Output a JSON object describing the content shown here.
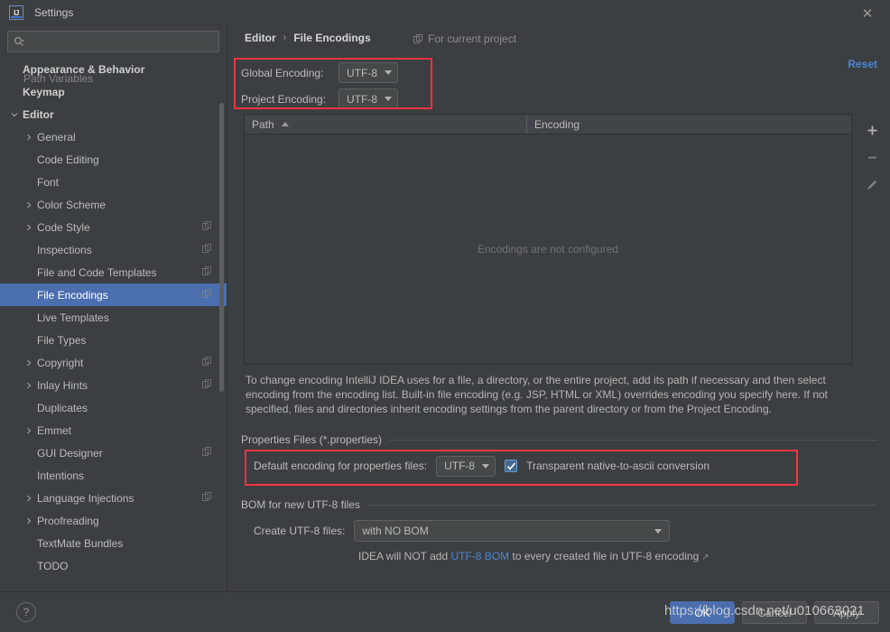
{
  "window": {
    "title": "Settings",
    "logo_text": "IJ",
    "close_icon": "close-icon"
  },
  "sidebar": {
    "search": {
      "value": "",
      "placeholder": ""
    },
    "items": [
      {
        "label": "Appearance & Behavior",
        "bold": true,
        "arrow": "",
        "indent": 0,
        "project_glyph": false
      },
      {
        "label": "Keymap",
        "bold": true,
        "arrow": "",
        "indent": 0,
        "project_glyph": false
      },
      {
        "label": "Editor",
        "bold": true,
        "arrow": "down",
        "indent": 0,
        "project_glyph": false
      },
      {
        "label": "General",
        "bold": false,
        "arrow": "right",
        "indent": 1,
        "project_glyph": false
      },
      {
        "label": "Code Editing",
        "bold": false,
        "arrow": "",
        "indent": 1,
        "project_glyph": false
      },
      {
        "label": "Font",
        "bold": false,
        "arrow": "",
        "indent": 1,
        "project_glyph": false
      },
      {
        "label": "Color Scheme",
        "bold": false,
        "arrow": "right",
        "indent": 1,
        "project_glyph": false
      },
      {
        "label": "Code Style",
        "bold": false,
        "arrow": "right",
        "indent": 1,
        "project_glyph": true
      },
      {
        "label": "Inspections",
        "bold": false,
        "arrow": "",
        "indent": 1,
        "project_glyph": true
      },
      {
        "label": "File and Code Templates",
        "bold": false,
        "arrow": "",
        "indent": 1,
        "project_glyph": true
      },
      {
        "label": "File Encodings",
        "bold": false,
        "arrow": "",
        "indent": 1,
        "project_glyph": true,
        "selected": true
      },
      {
        "label": "Live Templates",
        "bold": false,
        "arrow": "",
        "indent": 1,
        "project_glyph": false
      },
      {
        "label": "File Types",
        "bold": false,
        "arrow": "",
        "indent": 1,
        "project_glyph": false
      },
      {
        "label": "Copyright",
        "bold": false,
        "arrow": "right",
        "indent": 1,
        "project_glyph": true
      },
      {
        "label": "Inlay Hints",
        "bold": false,
        "arrow": "right",
        "indent": 1,
        "project_glyph": true
      },
      {
        "label": "Duplicates",
        "bold": false,
        "arrow": "",
        "indent": 1,
        "project_glyph": false
      },
      {
        "label": "Emmet",
        "bold": false,
        "arrow": "right",
        "indent": 1,
        "project_glyph": false
      },
      {
        "label": "GUI Designer",
        "bold": false,
        "arrow": "",
        "indent": 1,
        "project_glyph": true
      },
      {
        "label": "Intentions",
        "bold": false,
        "arrow": "",
        "indent": 1,
        "project_glyph": false
      },
      {
        "label": "Language Injections",
        "bold": false,
        "arrow": "right",
        "indent": 1,
        "project_glyph": true
      },
      {
        "label": "Proofreading",
        "bold": false,
        "arrow": "right",
        "indent": 1,
        "project_glyph": false
      },
      {
        "label": "TextMate Bundles",
        "bold": false,
        "arrow": "",
        "indent": 1,
        "project_glyph": false
      },
      {
        "label": "TODO",
        "bold": false,
        "arrow": "",
        "indent": 1,
        "project_glyph": false
      }
    ],
    "ghost_item": {
      "label": "Path Variables"
    }
  },
  "main": {
    "breadcrumb": {
      "parent": "Editor",
      "separator": "›",
      "current": "File Encodings"
    },
    "for_current_project": "For current project",
    "reset_label": "Reset",
    "global_encoding": {
      "label": "Global Encoding:",
      "value": "UTF-8"
    },
    "project_encoding": {
      "label": "Project Encoding:",
      "value": "UTF-8"
    },
    "table": {
      "columns": [
        "Path",
        "Encoding"
      ],
      "sort_column": "Path",
      "sort_direction": "ascending",
      "rows": [],
      "empty_message": "Encodings are not configured",
      "toolbar": [
        "add-icon",
        "remove-icon",
        "edit-icon"
      ]
    },
    "description": "To change encoding IntelliJ IDEA uses for a file, a directory, or the entire project, add its path if necessary and then select encoding from the encoding list. Built-in file encoding (e.g. JSP, HTML or XML) overrides encoding you specify here. If not specified, files and directories inherit encoding settings from the parent directory or from the Project Encoding.",
    "properties_group": {
      "title": "Properties Files (*.properties)",
      "default_encoding_label": "Default encoding for properties files:",
      "default_encoding_value": "UTF-8",
      "transparent_label": "Transparent native-to-ascii conversion",
      "transparent_checked": true,
      "checkbox_mark": "✓"
    },
    "bom_group": {
      "title": "BOM for new UTF-8 files",
      "create_label": "Create UTF-8 files:",
      "create_value": "with NO BOM",
      "hint_prefix": "IDEA will NOT add ",
      "hint_link": "UTF-8 BOM",
      "hint_suffix": " to every created file in UTF-8 encoding",
      "external_arrow": "↗"
    }
  },
  "bottom": {
    "help_label": "?",
    "ok_label": "OK",
    "cancel_label": "Cancel",
    "apply_label": "Apply"
  },
  "watermark": "https://blog.csdn.net/u010663021",
  "colors": {
    "background": "#3c3f41",
    "selection_blue": "#4b6eaf",
    "link_blue": "#4e86d6",
    "highlight_red": "#f5333f",
    "text": "#bbbbbb"
  }
}
